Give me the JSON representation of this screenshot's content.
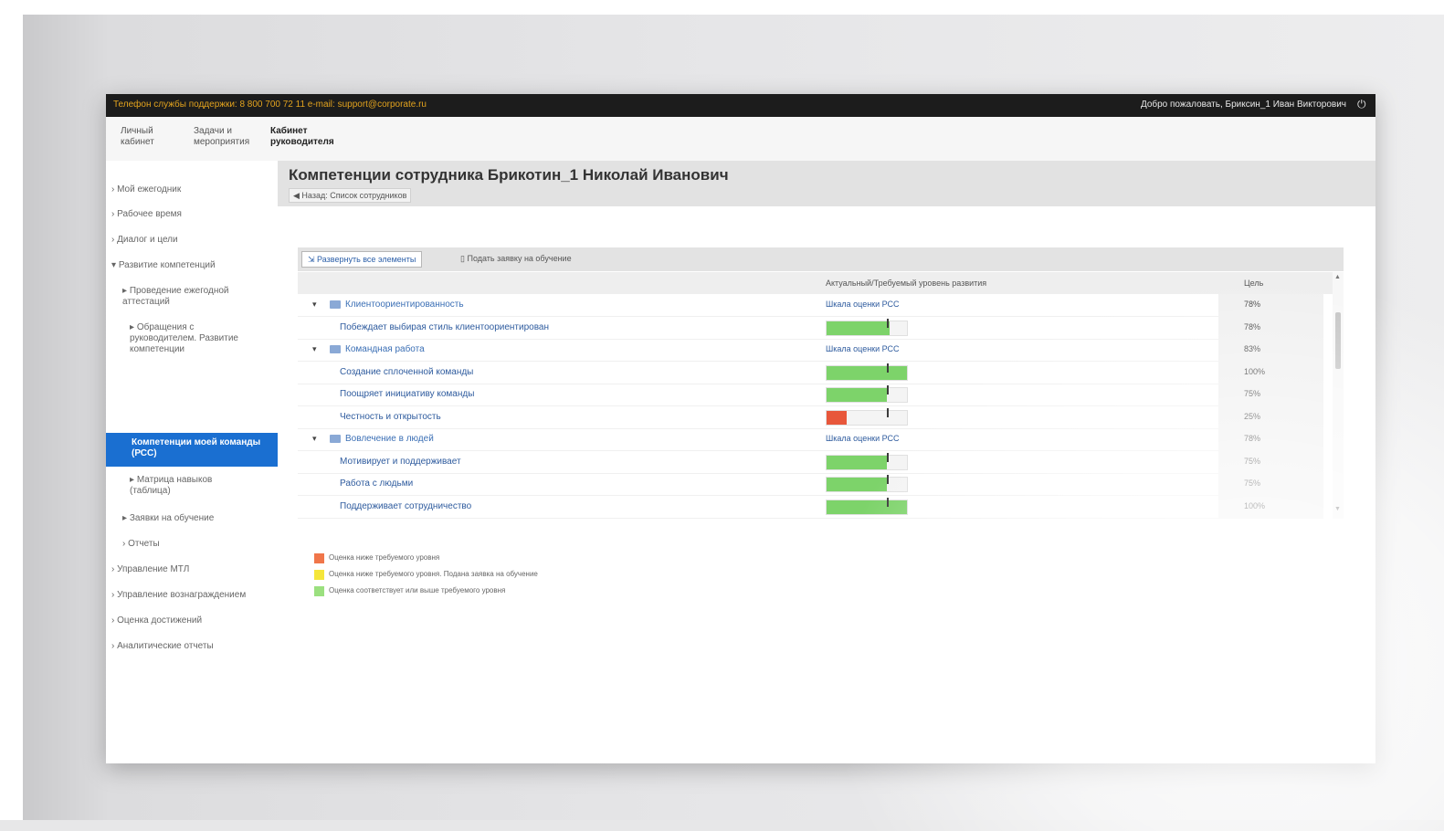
{
  "topbar": {
    "phone_text": "Телефон службы поддержки: 8 800 700 72 11 e-mail: support@corporate.ru",
    "welcome_text": "Добро пожаловать, Бриксин_1 Иван Викторович",
    "power_icon": "power-icon"
  },
  "nav_tabs": [
    {
      "label": "Личный кабинет"
    },
    {
      "label": "Задачи и мероприятия"
    },
    {
      "label": "Кабинет руководителя"
    }
  ],
  "sidebar": {
    "items": [
      {
        "label": "Мой ежегодник"
      },
      {
        "label": "Рабочее время"
      },
      {
        "label": "Диалог и цели"
      },
      {
        "label": "Развитие компетенций"
      },
      {
        "label": "Проведение ежегодной аттестаций"
      },
      {
        "label": "Обращения с руководителем. Развитие компетенции"
      },
      {
        "label": "Компетенции моей команды (РСС)"
      },
      {
        "label": "Матрица навыков (таблица)"
      },
      {
        "label": "Заявки на обучение"
      },
      {
        "label": "Отчеты"
      },
      {
        "label": "Управление МТЛ"
      },
      {
        "label": "Управление вознаграждением"
      },
      {
        "label": "Оценка достижений"
      },
      {
        "label": "Аналитические отчеты"
      }
    ]
  },
  "main": {
    "title": "Компетенции сотрудника Брикотин_1 Николай Иванович",
    "back_label": "Назад: Список сотрудников",
    "toolbar": {
      "expand_label": "Развернуть все элементы",
      "training_label": "Подать заявку на обучение"
    },
    "columns": {
      "level": "Актуальный/Требуемый уровень развития",
      "percent": "Цель"
    },
    "rows": [
      {
        "kind": "group",
        "name": "Клиентоориентированность",
        "scale": "Шкала оценки РСС",
        "percent": "78%"
      },
      {
        "kind": "item",
        "name": "Побеждает выбирая стиль клиентоориентирован",
        "fill": 0.78,
        "target": 0.75,
        "color": "#7dd36a",
        "percent": "78%"
      },
      {
        "kind": "group",
        "name": "Командная работа",
        "scale": "Шкала оценки РСС",
        "percent": "83%"
      },
      {
        "kind": "item",
        "name": "Создание сплоченной команды",
        "fill": 1.0,
        "target": 0.75,
        "color": "#7dd36a",
        "percent": "100%"
      },
      {
        "kind": "item",
        "name": "Поощряет инициативу команды",
        "fill": 0.75,
        "target": 0.75,
        "color": "#7dd36a",
        "percent": "75%"
      },
      {
        "kind": "item",
        "name": "Честность и открытость",
        "fill": 0.25,
        "target": 0.75,
        "color": "#e8573b",
        "percent": "25%"
      },
      {
        "kind": "group",
        "name": "Вовлечение в людей",
        "scale": "Шкала оценки РСС",
        "percent": "78%"
      },
      {
        "kind": "item",
        "name": "Мотивирует и поддерживает",
        "fill": 0.75,
        "target": 0.75,
        "color": "#7dd36a",
        "percent": "75%"
      },
      {
        "kind": "item",
        "name": "Работа с людьми",
        "fill": 0.75,
        "target": 0.75,
        "color": "#7dd36a",
        "percent": "75%"
      },
      {
        "kind": "item",
        "name": "Поддерживает сотрудничество",
        "fill": 1.0,
        "target": 0.75,
        "color": "#7dd36a",
        "percent": "100%"
      }
    ],
    "legend": [
      {
        "color": "#f0764a",
        "text": "Оценка ниже требуемого уровня"
      },
      {
        "color": "#f5e63a",
        "text": "Оценка ниже требуемого уровня. Подана заявка на обучение"
      },
      {
        "color": "#9be07f",
        "text": "Оценка соответствует или выше требуемого уровня"
      }
    ]
  }
}
